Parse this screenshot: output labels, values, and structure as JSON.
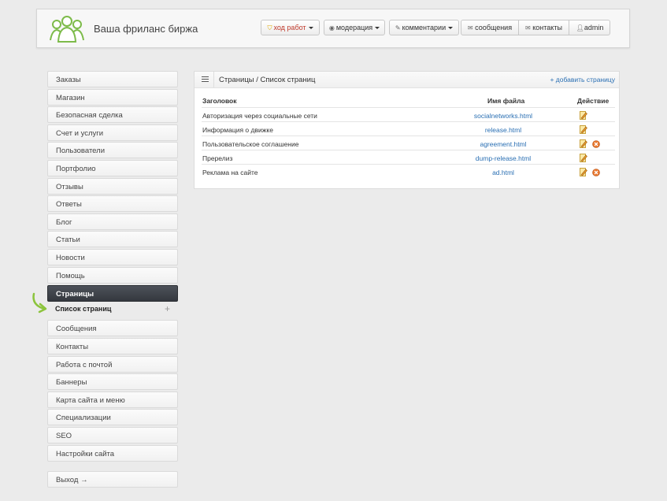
{
  "header": {
    "site_title": "Ваша фриланс биржа",
    "nav": {
      "progress": "ход работ",
      "moderation": "модерация",
      "comments": "комментарии",
      "messages": "сообщения",
      "contacts": "контакты",
      "user": "admin"
    }
  },
  "sidebar": {
    "items": [
      "Заказы",
      "Магазин",
      "Безопасная сделка",
      "Счет и услуги",
      "Пользователи",
      "Портфолио",
      "Отзывы",
      "Ответы",
      "Блог",
      "Статьи",
      "Новости",
      "Помощь",
      "Страницы"
    ],
    "sub_item": "Список страниц",
    "sub_plus": "+",
    "items_after": [
      "Сообщения",
      "Контакты",
      "Работа с почтой",
      "Баннеры",
      "Карта сайта и меню",
      "Специализации",
      "SEO",
      "Настройки сайта"
    ],
    "logout": "Выход →"
  },
  "main": {
    "breadcrumb": "Страницы / Список страниц",
    "add_link": "+ добавить страницу",
    "columns": {
      "title": "Заголовок",
      "file": "Имя файла",
      "action": "Действие"
    },
    "rows": [
      {
        "title": "Авторизация через социальные сети",
        "file": "socialnetworks.html",
        "deletable": false
      },
      {
        "title": "Информация о движке",
        "file": "release.html",
        "deletable": false
      },
      {
        "title": "Пользовательское соглашение",
        "file": "agreement.html",
        "deletable": true
      },
      {
        "title": "Пререлиз",
        "file": "dump-release.html",
        "deletable": false
      },
      {
        "title": "Реклама на сайте",
        "file": "ad.html",
        "deletable": true
      }
    ]
  },
  "colors": {
    "accent_link": "#2a6fb3",
    "active_menu": "#3d4147",
    "logo_green": "#7dbb4a",
    "delete_orange": "#e8762c"
  }
}
